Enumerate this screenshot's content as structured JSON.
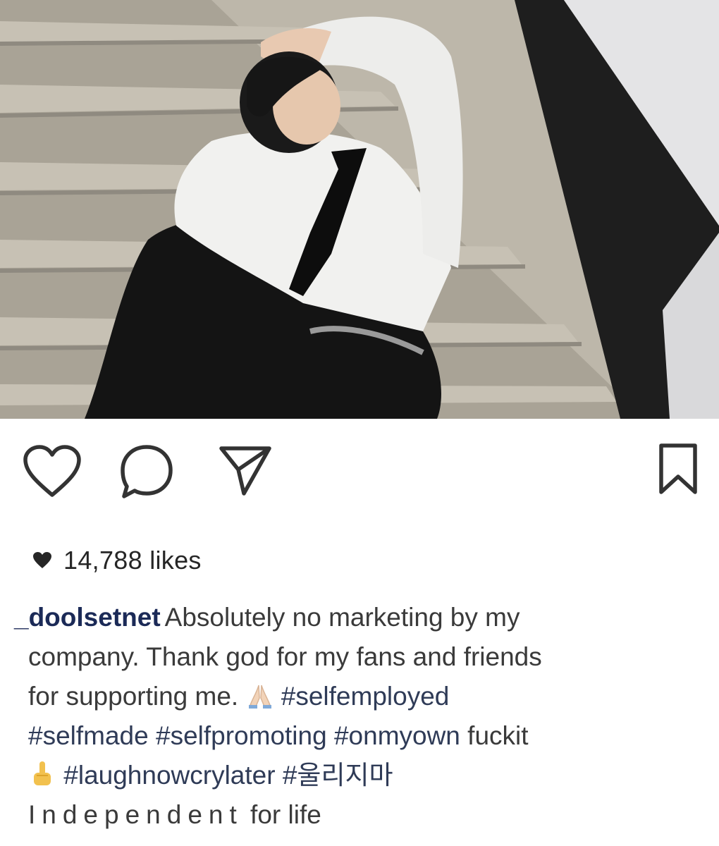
{
  "post": {
    "likes_text": "14,788 likes",
    "username": "_doolsetnet",
    "caption_line1": "Absolutely no marketing by my",
    "caption_line2": "company. Thank god for my fans and friends",
    "caption_line3_text": "for supporting me.",
    "caption_line3_tag": "#selfemployed",
    "caption_line4_tags": "#selfmade #selfpromoting #onmyown",
    "caption_line4_text": "fuckit",
    "caption_line5_tags": "#laughnowcrylater #울리지마",
    "caption_line6_spaced": "Independent",
    "caption_line6_text": "for life"
  },
  "icons": {
    "like": "heart-outline-icon",
    "comment": "comment-bubble-icon",
    "share": "paper-plane-icon",
    "save": "bookmark-icon",
    "likes_heart": "heart-filled-icon",
    "pray_emoji": "folded-hands-emoji",
    "finger_emoji": "raised-finger-emoji"
  },
  "colors": {
    "username": "#1b2a57",
    "text": "#3a3a3a",
    "icon_stroke": "#333333"
  }
}
